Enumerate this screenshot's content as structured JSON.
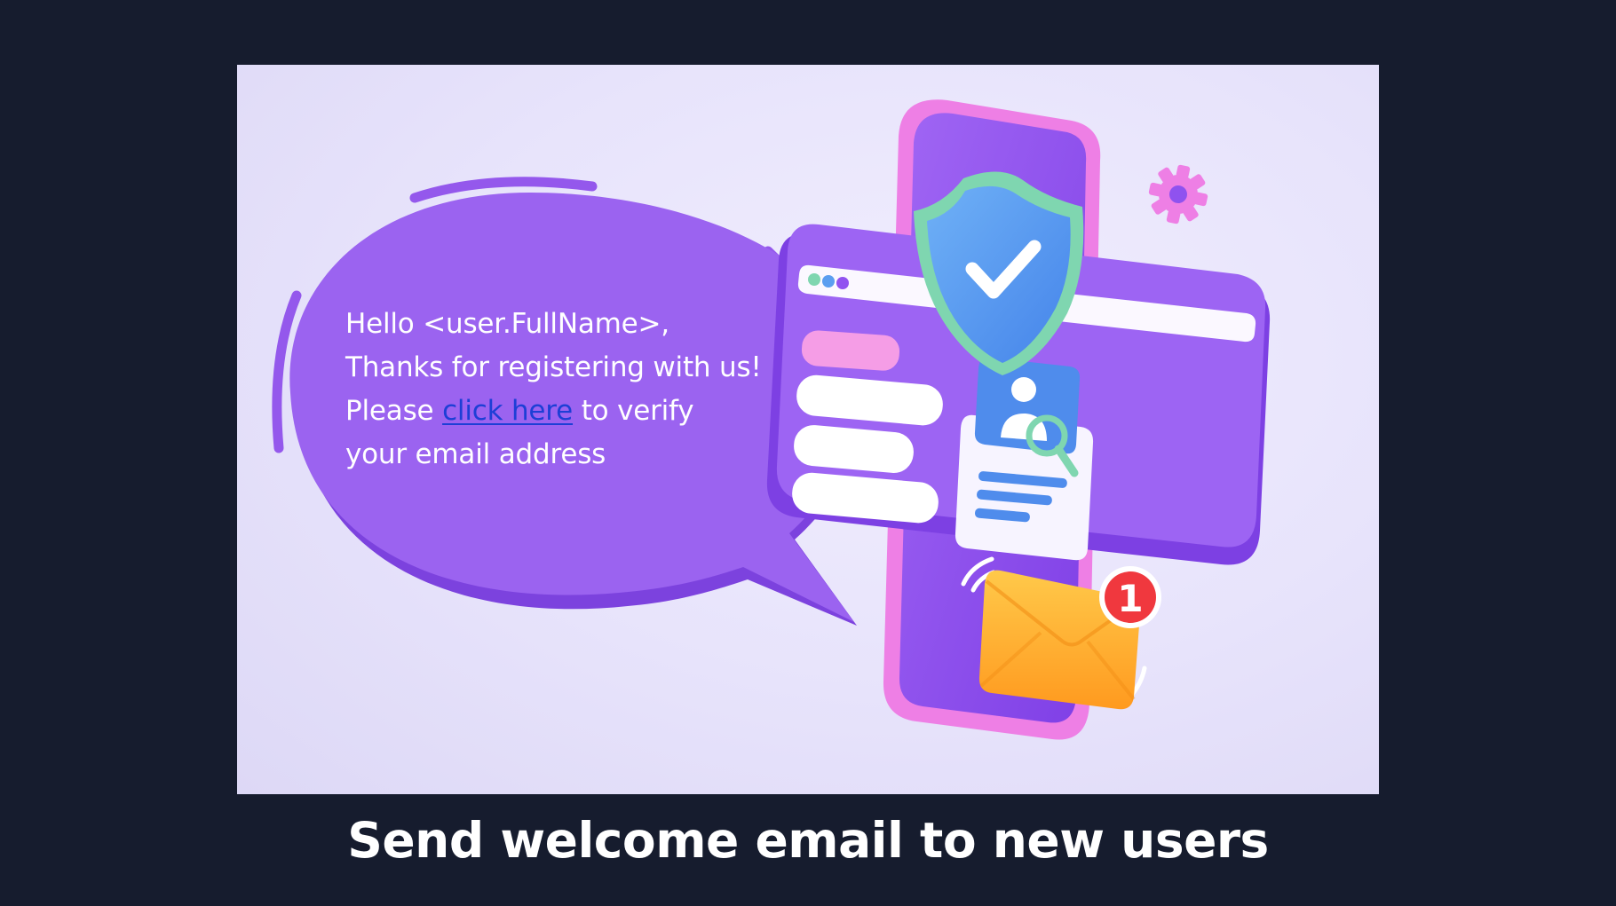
{
  "message": {
    "greeting": "Hello <user.FullName>,",
    "thanks": "Thanks for registering with us!",
    "please": "Please",
    "link_label": "click here",
    "verify": "to verify",
    "email_line": "your email address"
  },
  "notification": {
    "count": "1"
  },
  "caption": "Send welcome email to new users",
  "icons": [
    "speech-bubble-icon",
    "phone-illustration",
    "shield-check-icon",
    "gear-icon",
    "profile-search-icon",
    "envelope-icon",
    "notification-badge"
  ],
  "colors": {
    "background": "#161c2e",
    "bubble": "#9b63f0",
    "phone_frame": "#ee7fe5",
    "phone_body": "#9153f0",
    "shield": "#5b9ef0",
    "envelope": "#ffb52e",
    "badge": "#f0383e",
    "link": "#1d3fd6"
  }
}
